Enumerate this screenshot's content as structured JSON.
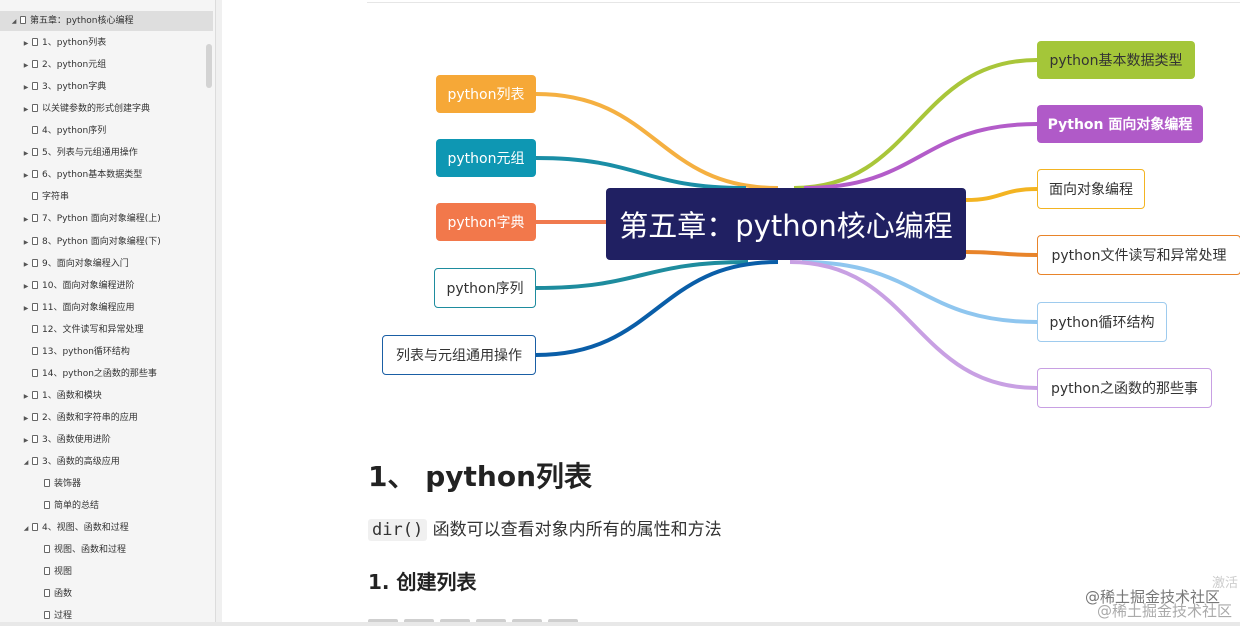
{
  "sidebar": {
    "items": [
      {
        "label": "第五章：python核心编程",
        "indent": 0,
        "expander": "▲",
        "selected": true
      },
      {
        "label": "1、python列表",
        "indent": 1,
        "expander": "▶"
      },
      {
        "label": "2、python元组",
        "indent": 1,
        "expander": "▶"
      },
      {
        "label": "3、python字典",
        "indent": 1,
        "expander": "▶"
      },
      {
        "label": "以关键参数的形式创建字典",
        "indent": 1,
        "expander": "▶"
      },
      {
        "label": "4、python序列",
        "indent": 1,
        "expander": ""
      },
      {
        "label": "5、列表与元组通用操作",
        "indent": 1,
        "expander": "▶"
      },
      {
        "label": "6、python基本数据类型",
        "indent": 1,
        "expander": "▶"
      },
      {
        "label": "字符串",
        "indent": 1,
        "expander": ""
      },
      {
        "label": "7、Python 面向对象编程(上)",
        "indent": 1,
        "expander": "▶"
      },
      {
        "label": "8、Python 面向对象编程(下)",
        "indent": 1,
        "expander": "▶"
      },
      {
        "label": "9、面向对象编程入门",
        "indent": 1,
        "expander": "▶"
      },
      {
        "label": "10、面向对象编程进阶",
        "indent": 1,
        "expander": "▶"
      },
      {
        "label": "11、面向对象编程应用",
        "indent": 1,
        "expander": "▶"
      },
      {
        "label": "12、文件读写和异常处理",
        "indent": 1,
        "expander": ""
      },
      {
        "label": "13、python循环结构",
        "indent": 1,
        "expander": ""
      },
      {
        "label": "14、python之函数的那些事",
        "indent": 1,
        "expander": ""
      },
      {
        "label": "1、函数和模块",
        "indent": 1,
        "expander": "▶"
      },
      {
        "label": "2、函数和字符串的应用",
        "indent": 1,
        "expander": "▶"
      },
      {
        "label": "3、函数使用进阶",
        "indent": 1,
        "expander": "▶"
      },
      {
        "label": "3、函数的高级应用",
        "indent": 1,
        "expander": "▲"
      },
      {
        "label": "装饰器",
        "indent": 2,
        "expander": ""
      },
      {
        "label": "简单的总结",
        "indent": 2,
        "expander": ""
      },
      {
        "label": "4、视图、函数和过程",
        "indent": 1,
        "expander": "▲"
      },
      {
        "label": "视图、函数和过程",
        "indent": 2,
        "expander": ""
      },
      {
        "label": "视图",
        "indent": 2,
        "expander": ""
      },
      {
        "label": "函数",
        "indent": 2,
        "expander": ""
      },
      {
        "label": "过程",
        "indent": 2,
        "expander": ""
      }
    ]
  },
  "mindmap": {
    "center": "第五章：python核心编程",
    "left_nodes": [
      {
        "label": "python列表",
        "bg": "#f6a837",
        "color": "#ffffff",
        "line": "#f5b041"
      },
      {
        "label": "python元组",
        "bg": "#0e97b3",
        "color": "#ffffff",
        "line": "#1a8ea6"
      },
      {
        "label": "python字典",
        "bg": "#f2784b",
        "color": "#ffffff",
        "line": "#f07a4f"
      },
      {
        "label": "python序列",
        "bg": "#ffffff",
        "color": "#333333",
        "line": "#1e8c9e",
        "border": "#1e8c9e"
      },
      {
        "label": "列表与元组通用操作",
        "bg": "#ffffff",
        "color": "#333333",
        "line": "#0a5ea8",
        "border": "#1a5fa5"
      }
    ],
    "right_nodes": [
      {
        "label": "python基本数据类型",
        "bg": "#a4c639",
        "color": "#333333",
        "line": "#a9c63a"
      },
      {
        "label": "Python 面向对象编程",
        "bg": "#b05ac8",
        "color": "#ffffff",
        "line": "#b35cc9",
        "bold": true
      },
      {
        "label": "面向对象编程",
        "bg": "#ffffff",
        "color": "#333333",
        "line": "#f3b422",
        "border": "#f3b422"
      },
      {
        "label": "python文件读写和异常处理",
        "bg": "#ffffff",
        "color": "#333333",
        "line": "#e8842a",
        "border": "#e8842a"
      },
      {
        "label": "python循环结构",
        "bg": "#ffffff",
        "color": "#333333",
        "line": "#8fc6ef",
        "border": "#9ecbee"
      },
      {
        "label": "python之函数的那些事",
        "bg": "#ffffff",
        "color": "#333333",
        "line": "#c8a0e3",
        "border": "#c8a0e3"
      }
    ]
  },
  "content": {
    "heading": "1、 python列表",
    "code": "dir()",
    "paragraph": " 函数可以查看对象内所有的属性和方法",
    "subheading": "1. 创建列表"
  },
  "watermark": {
    "line1": "@稀土掘金技术社区",
    "line2": "@稀土掘金技术社区",
    "activate": "激活"
  },
  "colors": {
    "center_bg": "#202062",
    "sidebar_bg": "#f5f5f5",
    "sidebar_selected": "#dedede"
  }
}
